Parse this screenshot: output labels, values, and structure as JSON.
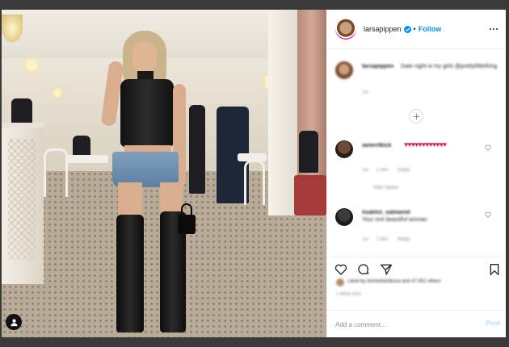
{
  "post": {
    "username": "larsapippen",
    "follow_label": "Follow",
    "dot": "•",
    "more_icon": "more-horizontal-icon",
    "verified_color": "#0095f6"
  },
  "comments": [
    {
      "username": "larsapippen",
      "text": "Date night w my girls @prettylittlething",
      "meta": "1w"
    },
    {
      "username": "iamerifkick",
      "hearts": "♥♥♥♥♥♥♥♥♥♥♥♥",
      "meta_time": "1w",
      "meta_likes": "1 like",
      "meta_reply": "Reply",
      "view_replies": "Hide replies"
    },
    {
      "username": "lisablizi_salmanid",
      "text": "Your one beautiful woman",
      "meta_time": "1w",
      "meta_likes": "1 like",
      "meta_reply": "Reply"
    }
  ],
  "likes_text": "Liked by dominikdulbosa and 47,452 others",
  "time_ago": "1 week ago",
  "add_comment": {
    "placeholder": "Add a comment…",
    "post_label": "Post"
  },
  "colors": {
    "accent": "#0095f6",
    "post_disabled": "#b2dffc",
    "heart_red": "#e0245e"
  }
}
